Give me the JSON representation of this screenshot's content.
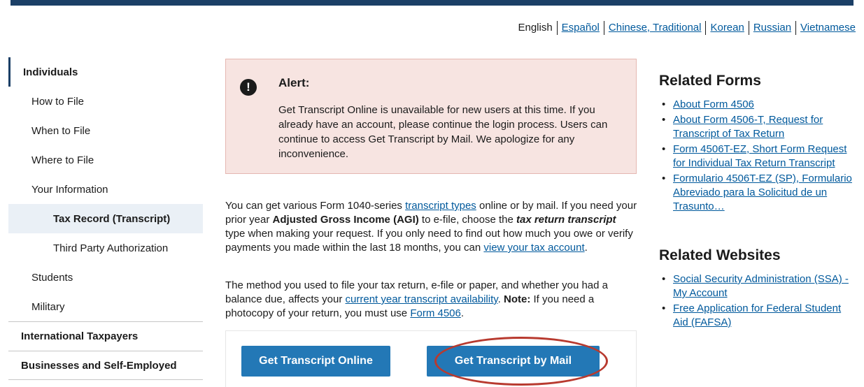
{
  "languages": [
    {
      "label": "English",
      "current": true
    },
    {
      "label": "Español",
      "current": false
    },
    {
      "label": "Chinese, Traditional",
      "current": false
    },
    {
      "label": "Korean",
      "current": false
    },
    {
      "label": "Russian",
      "current": false
    },
    {
      "label": "Vietnamese",
      "current": false
    }
  ],
  "sidebar": {
    "section_title": "Individuals",
    "items": [
      "How to File",
      "When to File",
      "Where to File",
      "Your Information"
    ],
    "sub_items": [
      "Tax Record (Transcript)",
      "Third Party Authorization"
    ],
    "items_after": [
      "Students",
      "Military"
    ],
    "top_level": [
      "International Taxpayers",
      "Businesses and Self-Employed"
    ]
  },
  "alert": {
    "icon": "exclamation-icon",
    "title": "Alert:",
    "body": "Get Transcript Online is unavailable for new users at this time. If you already have an account, please continue the login process. Users can continue to access Get Transcript by Mail. We apologize for any inconvenience."
  },
  "main": {
    "p1": {
      "t1": "You can get various Form 1040-series ",
      "link1": "transcript types",
      "t2": " online or by mail. If you need your prior year ",
      "bold1": "Adjusted Gross Income (AGI)",
      "t3": " to e-file, choose the ",
      "bold2": "tax return transcript",
      "t4": " type when making your request. If you only need to find out how much you owe or verify payments you made within the last 18 months, you can ",
      "link2": "view your tax account",
      "t5": "."
    },
    "p2": {
      "t1": "The method you used to file your tax return, e-file or paper, and whether you had a balance due, affects your ",
      "link1": "current year transcript availability",
      "t2": ". ",
      "bold1": "Note:",
      "t3": " If you need a photocopy of your return, you must use ",
      "link2": "Form 4506",
      "t4": "."
    },
    "buttons": {
      "online": "Get Transcript Online",
      "mail": "Get Transcript by Mail"
    }
  },
  "related_forms": {
    "title": "Related Forms",
    "links": [
      "About Form 4506",
      "About Form 4506-T, Request for Transcript of Tax Return",
      "Form 4506T-EZ, Short Form Request for Individual Tax Return Transcript",
      "Formulario 4506T-EZ (SP), Formulario Abreviado para la Solicitud de un Trasunto…"
    ]
  },
  "related_websites": {
    "title": "Related Websites",
    "links": [
      "Social Security Administration (SSA) - My Account",
      "Free Application for Federal Student Aid (FAFSA)"
    ]
  },
  "colors": {
    "header_bar": "#1b3f66",
    "link": "#00599c",
    "button": "#2378b6",
    "alert_bg": "#f7e4e1",
    "annotation_circle": "#b83a2f"
  }
}
